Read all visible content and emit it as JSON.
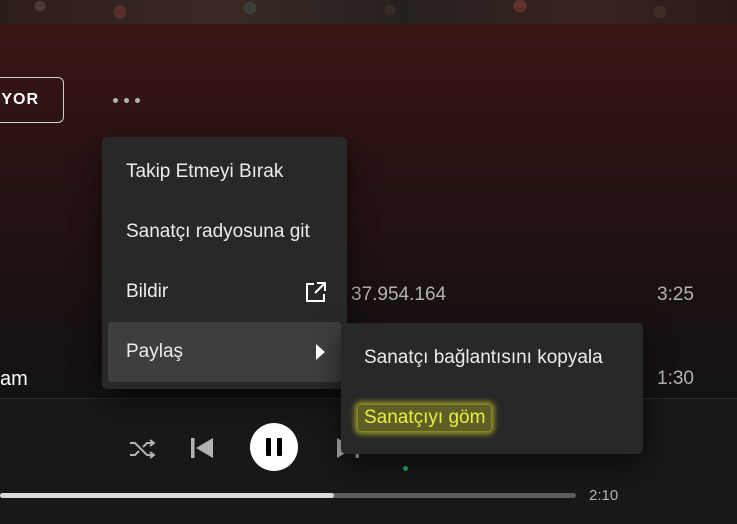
{
  "artist": {
    "follow_button": "YOR"
  },
  "tracks": [
    {
      "plays": "37.954.164",
      "duration": "3:25"
    },
    {
      "name": "am",
      "duration": "1:30"
    }
  ],
  "context_menu": {
    "items": [
      {
        "label": "Takip Etmeyi Bırak"
      },
      {
        "label": "Sanatçı radyosuna git"
      },
      {
        "label": "Bildir",
        "icon": "external-link-icon"
      },
      {
        "label": "Paylaş",
        "icon": "caret-right-icon"
      }
    ]
  },
  "share_submenu": {
    "items": [
      {
        "label": "Sanatçı bağlantısını kopyala"
      },
      {
        "label": "Sanatçıyı göm",
        "highlighted": true
      }
    ]
  },
  "player": {
    "total_time": "2:10",
    "progress": 0.58,
    "controls": [
      "shuffle-icon",
      "previous-icon",
      "pause-icon",
      "next-icon",
      "repeat-icon"
    ]
  },
  "colors": {
    "accent_green": "#1db954",
    "menu_bg": "#282828",
    "highlight": "#ecef24"
  }
}
